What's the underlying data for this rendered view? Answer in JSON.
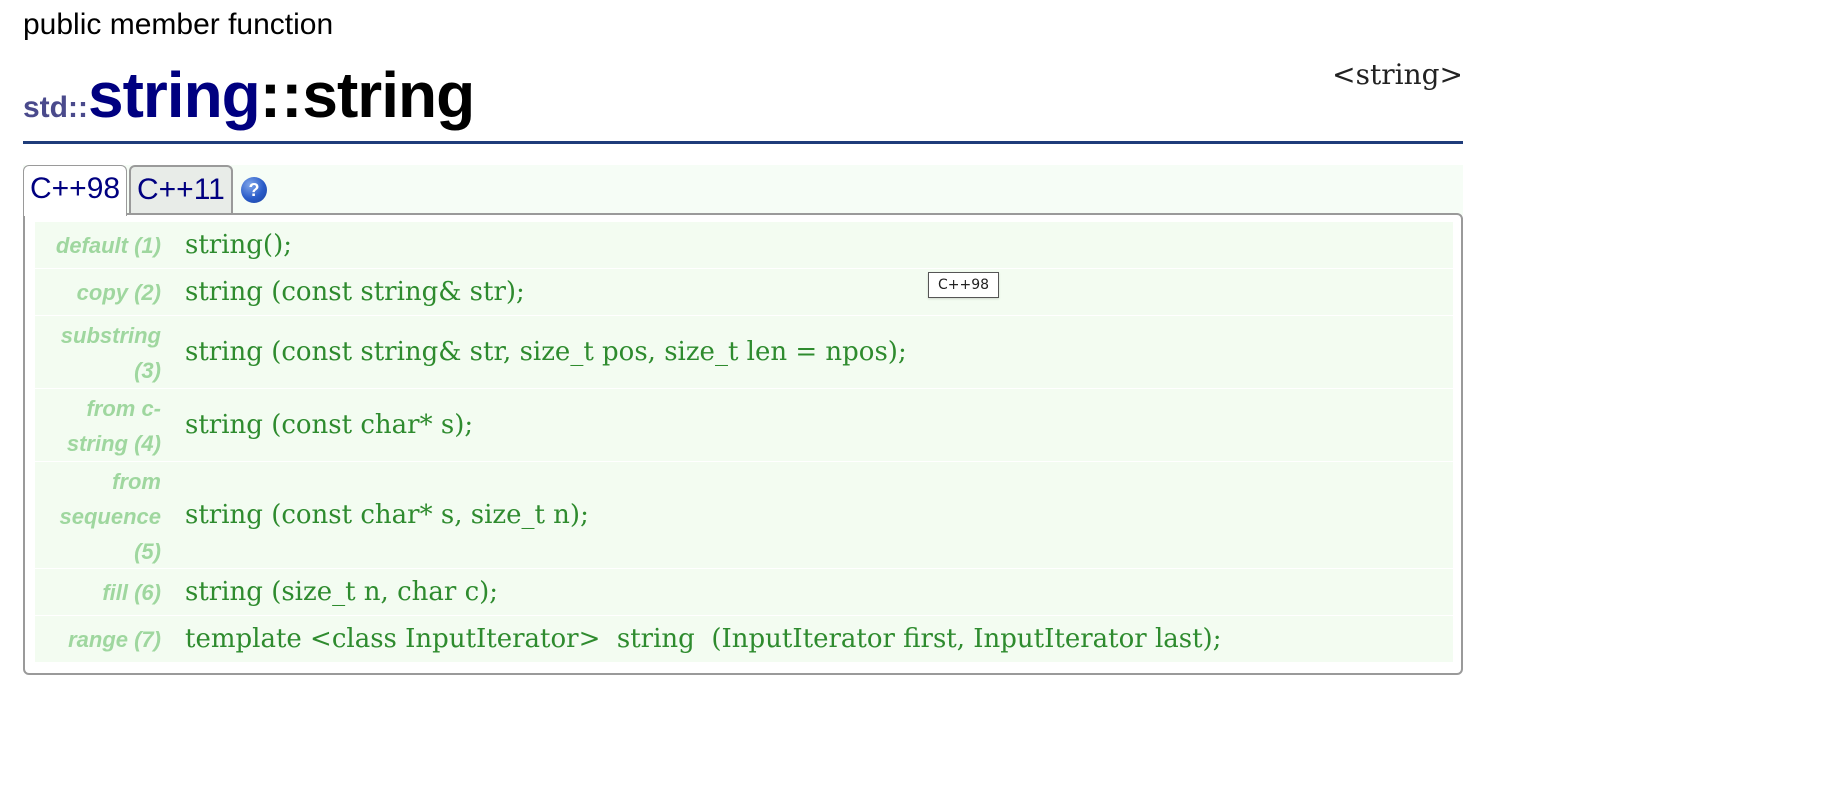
{
  "kind": "public member function",
  "header_file": "<string>",
  "title": {
    "namespace": "std::",
    "class": "string",
    "separator": "::",
    "function": "string"
  },
  "tabs": [
    {
      "label": "C++98",
      "active": true
    },
    {
      "label": "C++11",
      "active": false
    }
  ],
  "help_icon": "?",
  "tooltip": "C++98",
  "rows": [
    {
      "label": "default (1)",
      "code": "string();"
    },
    {
      "label": "copy (2)",
      "code": "string (const string& str);"
    },
    {
      "label": "substring (3)",
      "code": "string (const string& str, size_t pos, size_t len = npos);"
    },
    {
      "label": "from c-string (4)",
      "code": "string (const char* s);"
    },
    {
      "label": "from sequence (5)",
      "code": "string (const char* s, size_t n);"
    },
    {
      "label": "fill (6)",
      "code": "string (size_t n, char c);"
    },
    {
      "label": "range (7)",
      "code": "template <class InputIterator>  string  (InputIterator first, InputIterator last);"
    }
  ],
  "colors": {
    "rule": "#1f3c7a",
    "class_name": "#000080",
    "code": "#2e8b2e",
    "label": "#9fd79f",
    "row_bg": "#f3fcf1"
  }
}
